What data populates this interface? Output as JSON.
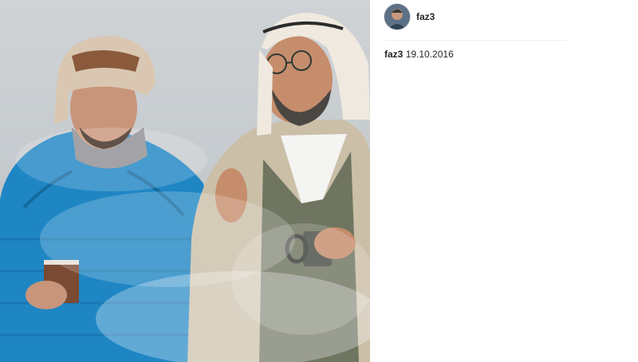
{
  "post": {
    "photo_alt": "Two men in desert holding coffee cups",
    "header": {
      "username": "faz3",
      "avatar_icon": "profile-avatar-icon"
    },
    "caption": {
      "username": "faz3",
      "text": "19.10.2016"
    }
  },
  "colors": {
    "jacket_blue": "#1f86c4",
    "robe_beige": "#cbbfa8",
    "vest_green": "#6f7560",
    "divider": "#efefef"
  }
}
